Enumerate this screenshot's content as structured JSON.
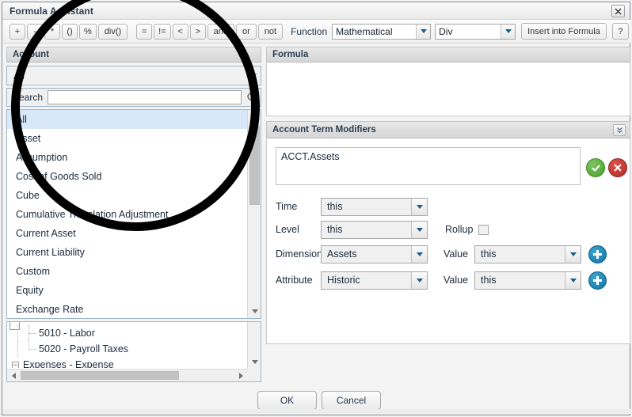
{
  "window": {
    "title": "Formula Assistant",
    "close_icon": "close-x-icon"
  },
  "toolbar": {
    "operator_buttons": [
      "+",
      "-",
      "*",
      "()",
      "%",
      "div()"
    ],
    "comparison_buttons": [
      "=",
      "!=",
      "<",
      ">",
      "and",
      "or",
      "not"
    ],
    "function_label": "Function",
    "function_category": "Mathematical",
    "function_name": "Div",
    "insert_label": "Insert into Formula",
    "help_label": "?"
  },
  "account_panel": {
    "header": "Account",
    "filter_value": "All",
    "search_label": "Search",
    "search_value": "",
    "search_placeholder": "",
    "search_icon": "magnifier-icon",
    "list": [
      "All",
      "Asset",
      "Assumption",
      "Cost of Goods Sold",
      "Cube",
      "Cumulative Translation Adjustment",
      "Current Asset",
      "Current Liability",
      "Custom",
      "Equity",
      "Exchange Rate"
    ],
    "list_selected": "All",
    "tree": [
      {
        "label": "5010 - Labor",
        "level": 2,
        "toggle": ""
      },
      {
        "label": "5020 - Payroll Taxes",
        "level": 2,
        "toggle": ""
      },
      {
        "label": "Expenses - Expense",
        "level": 0,
        "toggle": "−"
      }
    ]
  },
  "formula_panel": {
    "header": "Formula",
    "value": ""
  },
  "modifiers_panel": {
    "header": "Account Term Modifiers",
    "collapse_icon": "chevron-double-down-icon",
    "term_value": "ACCT.Assets",
    "accept_icon": "check-circle-icon",
    "reject_icon": "x-circle-icon",
    "rows": [
      {
        "label": "Time",
        "value": "this"
      },
      {
        "label": "Level",
        "value": "this"
      },
      {
        "label": "Dimension",
        "value": "Assets"
      },
      {
        "label": "Attribute",
        "value": "Historic"
      }
    ],
    "rollup_label": "Rollup",
    "rollup_checked": false,
    "value_label": "Value",
    "dimension_value": "this",
    "attribute_value": "this",
    "add_icon": "plus-circle-icon"
  },
  "footer": {
    "ok_label": "OK",
    "cancel_label": "Cancel"
  },
  "colors": {
    "accent_blue": "#0e76a8",
    "ok_green": "#48a02b",
    "cancel_red": "#b02a26",
    "selection": "#d8e8f8"
  }
}
